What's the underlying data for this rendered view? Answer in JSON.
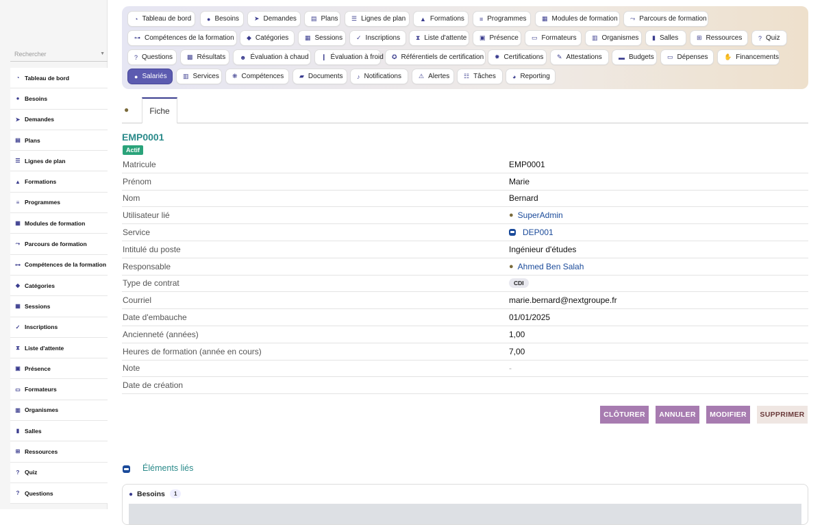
{
  "sidebar": {
    "search_placeholder": "Rechercher",
    "items": [
      {
        "label": "Tableau de bord",
        "icon": "gauge-icon",
        "glyph": "◔"
      },
      {
        "label": "Besoins",
        "icon": "lightbulb-icon",
        "glyph": "●"
      },
      {
        "label": "Demandes",
        "icon": "paper-plane-icon",
        "glyph": "➤"
      },
      {
        "label": "Plans",
        "icon": "clipboard-icon",
        "glyph": "▤"
      },
      {
        "label": "Lignes de plan",
        "icon": "list-icon",
        "glyph": "☰"
      },
      {
        "label": "Formations",
        "icon": "graduation-cap-icon",
        "glyph": "▲"
      },
      {
        "label": "Programmes",
        "icon": "bars-icon",
        "glyph": "≡"
      },
      {
        "label": "Modules de formation",
        "icon": "cubes-icon",
        "glyph": "▦"
      },
      {
        "label": "Parcours de formation",
        "icon": "route-icon",
        "glyph": "⤳"
      },
      {
        "label": "Compétences de la formation",
        "icon": "network-icon",
        "glyph": "⊶"
      },
      {
        "label": "Catégories",
        "icon": "tags-icon",
        "glyph": "◆"
      },
      {
        "label": "Sessions",
        "icon": "calendar-icon",
        "glyph": "▦"
      },
      {
        "label": "Inscriptions",
        "icon": "user-check-icon",
        "glyph": "✓"
      },
      {
        "label": "Liste d'attente",
        "icon": "hourglass-icon",
        "glyph": "⧗"
      },
      {
        "label": "Présence",
        "icon": "clipboard-check-icon",
        "glyph": "▣"
      },
      {
        "label": "Formateurs",
        "icon": "chalkboard-icon",
        "glyph": "▭"
      },
      {
        "label": "Organismes",
        "icon": "building-icon",
        "glyph": "▥"
      },
      {
        "label": "Salles",
        "icon": "door-icon",
        "glyph": "▮"
      },
      {
        "label": "Ressources",
        "icon": "sitemap-icon",
        "glyph": "⊞"
      },
      {
        "label": "Quiz",
        "icon": "question-circle-icon",
        "glyph": "?"
      },
      {
        "label": "Questions",
        "icon": "question-icon",
        "glyph": "?"
      }
    ]
  },
  "top_tabs": [
    {
      "label": "Tableau de bord",
      "icon": "gauge-icon",
      "glyph": "◔"
    },
    {
      "label": "Besoins",
      "icon": "lightbulb-icon",
      "glyph": "●"
    },
    {
      "label": "Demandes",
      "icon": "paper-plane-icon",
      "glyph": "➤"
    },
    {
      "label": "Plans",
      "icon": "clipboard-icon",
      "glyph": "▤"
    },
    {
      "label": "Lignes de plan",
      "icon": "list-icon",
      "glyph": "☰"
    },
    {
      "label": "Formations",
      "icon": "graduation-cap-icon",
      "glyph": "▲"
    },
    {
      "label": "Programmes",
      "icon": "bars-icon",
      "glyph": "≡"
    },
    {
      "label": "Modules de formation",
      "icon": "cubes-icon",
      "glyph": "▦"
    },
    {
      "label": "Parcours de formation",
      "icon": "route-icon",
      "glyph": "⤳"
    },
    {
      "label": "Compétences de la formation",
      "icon": "network-icon",
      "glyph": "⊶"
    },
    {
      "label": "Catégories",
      "icon": "tags-icon",
      "glyph": "◆"
    },
    {
      "label": "Sessions",
      "icon": "calendar-icon",
      "glyph": "▦"
    },
    {
      "label": "Inscriptions",
      "icon": "user-check-icon",
      "glyph": "✓"
    },
    {
      "label": "Liste d'attente",
      "icon": "hourglass-icon",
      "glyph": "⧗"
    },
    {
      "label": "Présence",
      "icon": "clipboard-check-icon",
      "glyph": "▣"
    },
    {
      "label": "Formateurs",
      "icon": "chalkboard-icon",
      "glyph": "▭"
    },
    {
      "label": "Organismes",
      "icon": "building-icon",
      "glyph": "▥"
    },
    {
      "label": "Salles",
      "icon": "door-icon",
      "glyph": "▮"
    },
    {
      "label": "Ressources",
      "icon": "sitemap-icon",
      "glyph": "⊞"
    },
    {
      "label": "Quiz",
      "icon": "question-circle-icon",
      "glyph": "?"
    },
    {
      "label": "Questions",
      "icon": "question-icon",
      "glyph": "?"
    },
    {
      "label": "Résultats",
      "icon": "poll-icon",
      "glyph": "▩"
    },
    {
      "label": "Évaluation à chaud",
      "icon": "smile-icon",
      "glyph": "☻"
    },
    {
      "label": "Évaluation à froid",
      "icon": "thermometer-icon",
      "glyph": "❙"
    },
    {
      "label": "Référentiels de certification",
      "icon": "award-icon",
      "glyph": "✪"
    },
    {
      "label": "Certifications",
      "icon": "certificate-icon",
      "glyph": "✹"
    },
    {
      "label": "Attestations",
      "icon": "file-signature-icon",
      "glyph": "✎"
    },
    {
      "label": "Budgets",
      "icon": "wallet-icon",
      "glyph": "▬"
    },
    {
      "label": "Dépenses",
      "icon": "money-bill-icon",
      "glyph": "▭"
    },
    {
      "label": "Financements",
      "icon": "hand-holding-icon",
      "glyph": "✋"
    },
    {
      "label": "Salariés",
      "icon": "user-icon",
      "glyph": "●",
      "active": true
    },
    {
      "label": "Services",
      "icon": "building-icon",
      "glyph": "▥"
    },
    {
      "label": "Compétences",
      "icon": "brain-icon",
      "glyph": "❋"
    },
    {
      "label": "Documents",
      "icon": "folder-open-icon",
      "glyph": "▰"
    },
    {
      "label": "Notifications",
      "icon": "bell-icon",
      "glyph": "♪"
    },
    {
      "label": "Alertes",
      "icon": "warning-icon",
      "glyph": "⚠"
    },
    {
      "label": "Tâches",
      "icon": "tasks-icon",
      "glyph": "☷"
    },
    {
      "label": "Reporting",
      "icon": "chart-pie-icon",
      "glyph": "◕"
    }
  ],
  "subtabs": {
    "active_label": "Fiche",
    "icon": "user-icon"
  },
  "record": {
    "reference": "EMP0001",
    "status": "Actif",
    "status_color": "#2aa37a",
    "fields": [
      {
        "label": "Matricule",
        "value": "EMP0001"
      },
      {
        "label": "Prénom",
        "value": "Marie"
      },
      {
        "label": "Nom",
        "value": "Bernard"
      },
      {
        "label": "Utilisateur lié",
        "value": "SuperAdmin",
        "kind": "person-link"
      },
      {
        "label": "Service",
        "value": "DEP001",
        "kind": "service-link"
      },
      {
        "label": "Intitulé du poste",
        "value": "Ingénieur d'études"
      },
      {
        "label": "Responsable",
        "value": "Ahmed Ben Salah",
        "kind": "person-link"
      },
      {
        "label": "Type de contrat",
        "value": "CDI",
        "kind": "badge"
      },
      {
        "label": "Courriel",
        "value": "marie.bernard@nextgroupe.fr"
      },
      {
        "label": "Date d'embauche",
        "value": "01/01/2025"
      },
      {
        "label": "Ancienneté (années)",
        "value": "1,00"
      },
      {
        "label": "Heures de formation (année en cours)",
        "value": "7,00"
      },
      {
        "label": "Note",
        "value": "-",
        "kind": "muted"
      },
      {
        "label": "Date de création",
        "value": ""
      }
    ]
  },
  "actions": {
    "close_label": "CLÔTURER",
    "cancel_label": "ANNULER",
    "edit_label": "MODIFIER",
    "delete_label": "SUPPRIMER",
    "primary_color": "#a77bb0"
  },
  "linked": {
    "title": "Éléments liés",
    "card_name": "Besoins",
    "card_count": "1"
  }
}
